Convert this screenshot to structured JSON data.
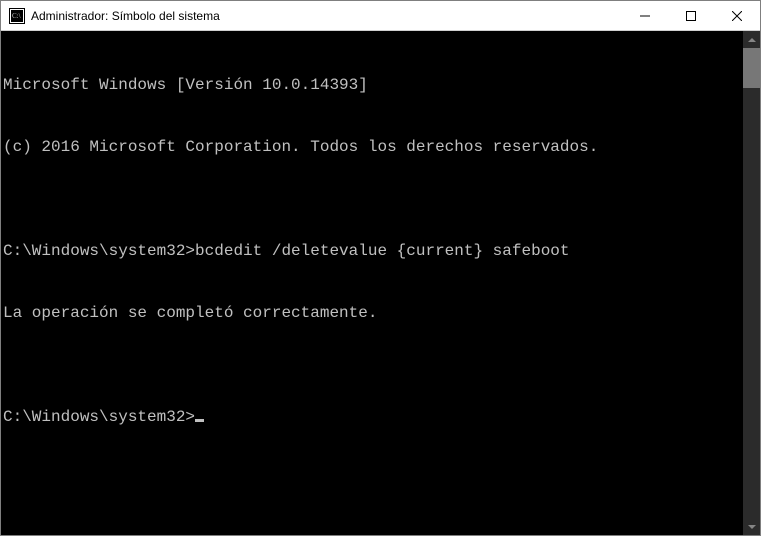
{
  "window": {
    "title": "Administrador: Símbolo del sistema",
    "icon_name": "cmd-icon"
  },
  "controls": {
    "minimize": "minimize",
    "maximize": "maximize",
    "close": "close"
  },
  "terminal": {
    "lines": [
      "Microsoft Windows [Versión 10.0.14393]",
      "(c) 2016 Microsoft Corporation. Todos los derechos reservados.",
      "",
      "C:\\Windows\\system32>bcdedit /deletevalue {current} safeboot",
      "La operación se completó correctamente.",
      "",
      "C:\\Windows\\system32>"
    ],
    "prompt": "C:\\Windows\\system32>",
    "last_command": "bcdedit /deletevalue {current} safeboot",
    "last_output": "La operación se completó correctamente."
  },
  "colors": {
    "terminal_bg": "#000000",
    "terminal_fg": "#c0c0c0"
  }
}
